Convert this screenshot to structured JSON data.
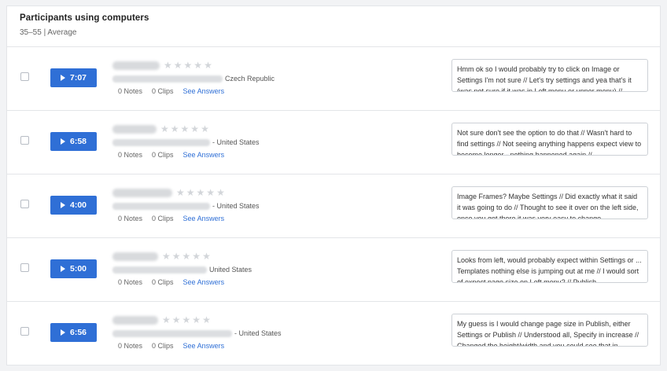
{
  "header": {
    "title": "Participants using computers",
    "subtitle": "35–55 | Average"
  },
  "colors": {
    "accent": "#2f6fd6",
    "star_empty": "#d3d6da"
  },
  "participants": [
    {
      "duration": "7:07",
      "location": "Czech Republic",
      "notes": "0 Notes",
      "clips": "0 Clips",
      "see_answers": "See Answers",
      "transcript": "Hmm ok so I would probably try to click on Image or Settings I'm not sure // Let's try settings and yea that's it (was not sure if it was in Left menu or upper menu) //"
    },
    {
      "duration": "6:58",
      "location": "- United States",
      "notes": "0 Notes",
      "clips": "0 Clips",
      "see_answers": "See Answers",
      "transcript": "Not sure don't see the option to do that // Wasn't hard to find settings // Not seeing anything happens expect view to become longer - nothing happened again //"
    },
    {
      "duration": "4:00",
      "location": "- United States",
      "notes": "0 Notes",
      "clips": "0 Clips",
      "see_answers": "See Answers",
      "transcript": "Image Frames? Maybe Settings // Did exactly what it said it was going to do // Thought to see it over on the left side, once you got there it was very easy to change"
    },
    {
      "duration": "5:00",
      "location": "United States",
      "notes": "0 Notes",
      "clips": "0 Clips",
      "see_answers": "See Answers",
      "transcript": "Looks from left, would probably expect within Settings or ... Templates nothing else is jumping out at me // I would sort of expect page size on Left menu? // Publish"
    },
    {
      "duration": "6:56",
      "location": "- United States",
      "notes": "0 Notes",
      "clips": "0 Clips",
      "see_answers": "See Answers",
      "transcript": "My guess is I would change page size in Publish, either Settings or Publish // Understood all, Specify in increase // Changed the height/width and you could see that in"
    }
  ]
}
